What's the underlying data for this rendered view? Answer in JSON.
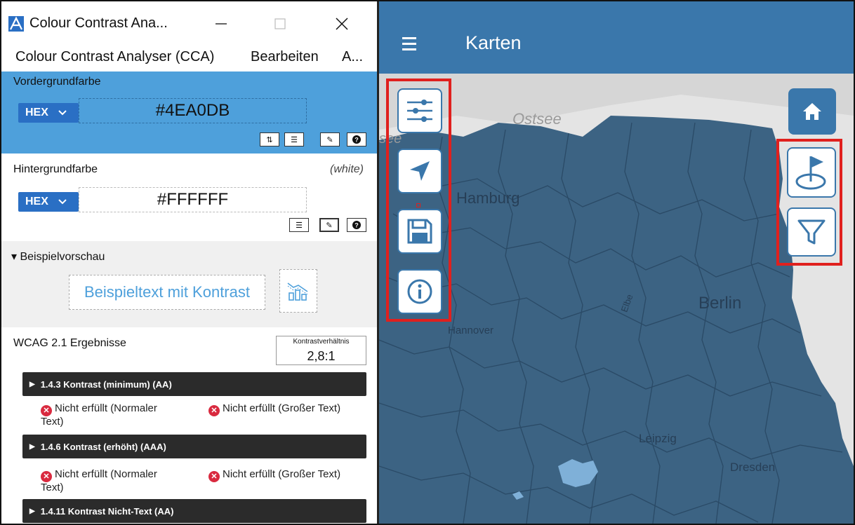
{
  "cca": {
    "window_title": "Colour Contrast Ana...",
    "menu": [
      "Colour Contrast Analyser (CCA)",
      "Bearbeiten",
      "A..."
    ],
    "foreground": {
      "label": "Vordergrundfarbe",
      "format": "HEX",
      "value": "#4EA0DB",
      "color": "#4ea0db"
    },
    "background": {
      "label": "Hintergrundfarbe",
      "name_hint": "(white)",
      "format": "HEX",
      "value": "#FFFFFF"
    },
    "preview": {
      "label": "▾ Beispielvorschau",
      "sample_text": "Beispieltext mit Kontrast"
    },
    "wcag": {
      "title": "WCAG 2.1 Ergebnisse",
      "ratio_label": "Kontrastverhältnis",
      "ratio_value": "2,8:1",
      "criteria": [
        {
          "label": "1.4.3 Kontrast (minimum) (AA)",
          "normal": "Nicht erfüllt (Normaler Text)",
          "large": "Nicht erfüllt (Großer Text)"
        },
        {
          "label": "1.4.6 Kontrast (erhöht) (AAA)",
          "normal": "Nicht erfüllt (Normaler Text)",
          "large": "Nicht erfüllt (Großer Text)"
        },
        {
          "label": "1.4.11 Kontrast Nicht-Text (AA)"
        }
      ]
    }
  },
  "map_app": {
    "header_title": "Karten",
    "header_color": "#3a77ab",
    "map_labels": [
      "Ostsee",
      "see",
      "Hamburg",
      "Hannover",
      "Berlin",
      "Leipzig",
      "Dresden",
      "Elbe"
    ],
    "left_controls": [
      "sliders-icon",
      "navigation-arrow-icon",
      "save-icon",
      "info-icon"
    ],
    "right_controls": [
      "home-icon",
      "flag-location-icon",
      "filter-icon"
    ],
    "highlight_color": "#e0201e"
  }
}
